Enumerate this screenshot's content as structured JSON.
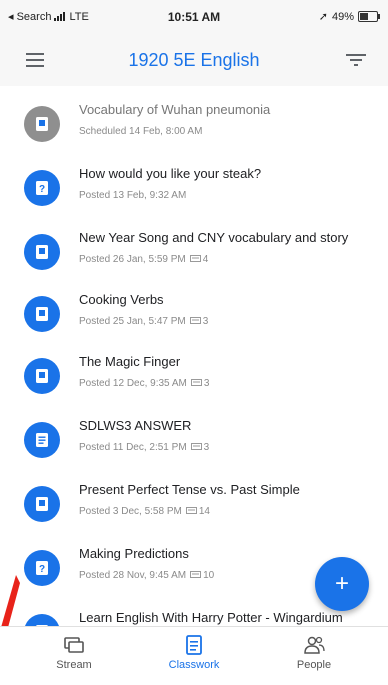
{
  "status": {
    "carrier": "◂ Search",
    "network": "LTE",
    "time": "10:51 AM",
    "battery": "49%"
  },
  "header": {
    "title": "1920 5E English"
  },
  "items": [
    {
      "title": "Vocabulary of Wuhan pneumonia",
      "meta": "Scheduled 14 Feb, 8:00 AM",
      "count": "",
      "icon": "material-icon",
      "scheduled": true
    },
    {
      "title": "How would you like your steak?",
      "meta": "Posted 13 Feb, 9:32 AM",
      "count": "",
      "icon": "question-icon",
      "scheduled": false
    },
    {
      "title": "New Year Song  and CNY vocabulary and story",
      "meta": "Posted 26 Jan, 5:59 PM",
      "count": "4",
      "icon": "material-icon",
      "scheduled": false
    },
    {
      "title": "Cooking Verbs",
      "meta": "Posted 25 Jan, 5:47 PM",
      "count": "3",
      "icon": "material-icon",
      "scheduled": false
    },
    {
      "title": "The Magic Finger",
      "meta": "Posted 12 Dec, 9:35 AM",
      "count": "3",
      "icon": "material-icon",
      "scheduled": false
    },
    {
      "title": "SDLWS3 ANSWER",
      "meta": "Posted 11 Dec, 2:51 PM",
      "count": "3",
      "icon": "assignment-icon",
      "scheduled": false
    },
    {
      "title": "Present Perfect Tense vs. Past Simple",
      "meta": "Posted 3 Dec, 5:58 PM",
      "count": "14",
      "icon": "material-icon",
      "scheduled": false
    },
    {
      "title": "Making Predictions",
      "meta": "Posted 28 Nov, 9:45 AM",
      "count": "10",
      "icon": "question-icon",
      "scheduled": false
    },
    {
      "title": "Learn English With Harry Potter - Wingardium",
      "meta": "",
      "count": "",
      "icon": "material-icon",
      "scheduled": false
    }
  ],
  "fab": {
    "label": "+"
  },
  "nav": {
    "stream": "Stream",
    "classwork": "Classwork",
    "people": "People"
  },
  "colors": {
    "accent": "#1a73e8",
    "scheduled": "#8f8f8f"
  }
}
